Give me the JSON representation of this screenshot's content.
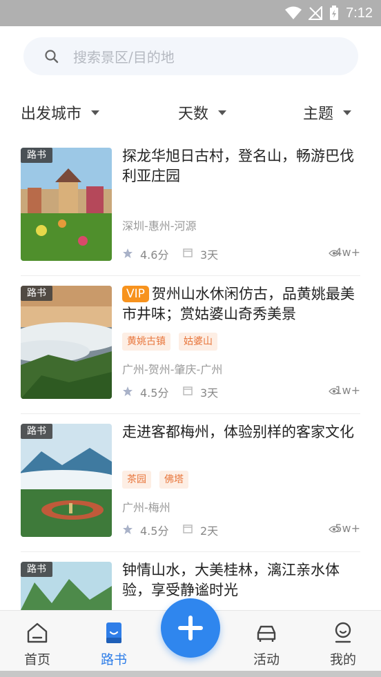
{
  "status_bar": {
    "time": "7:12"
  },
  "search": {
    "placeholder": "搜索景区/目的地"
  },
  "filters": [
    {
      "label": "出发城市"
    },
    {
      "label": "天数"
    },
    {
      "label": "主题"
    }
  ],
  "cards": [
    {
      "tag": "路书",
      "title": "探龙华旭日古村，登名山，畅游巴伐利亚庄园",
      "vip": "",
      "chips": [],
      "route": "深圳-惠州-河源",
      "score": "4.6分",
      "days": "3天",
      "views": "4w+"
    },
    {
      "tag": "路书",
      "title": "贺州山水休闲仿古，品黄姚最美市井味；赏姑婆山奇秀美景",
      "vip": "VIP",
      "chips": [
        "黄姚古镇",
        "姑婆山"
      ],
      "route": "广州-贺州-肇庆-广州",
      "score": "4.5分",
      "days": "3天",
      "views": "1w+"
    },
    {
      "tag": "路书",
      "title": "走进客都梅州，体验别样的客家文化",
      "vip": "",
      "chips": [
        "茶园",
        "佛塔"
      ],
      "route": "广州-梅州",
      "score": "4.5分",
      "days": "2天",
      "views": "5w+"
    },
    {
      "tag": "路书",
      "title": "钟情山水，大美桂林，漓江亲水体验，享受静谧时光",
      "vip": "",
      "chips": [],
      "route": "",
      "score": "",
      "days": "",
      "views": ""
    }
  ],
  "tabs": [
    {
      "label": "首页",
      "icon": "home-icon",
      "active": false
    },
    {
      "label": "路书",
      "icon": "book-icon",
      "active": true
    },
    {
      "label": "活动",
      "icon": "car-icon",
      "active": false
    },
    {
      "label": "我的",
      "icon": "user-icon",
      "active": false
    }
  ],
  "colors": {
    "accent": "#2f7ee8",
    "vip": "#f7931e",
    "chip_text": "#e8763c",
    "chip_bg": "#fdeee4"
  }
}
